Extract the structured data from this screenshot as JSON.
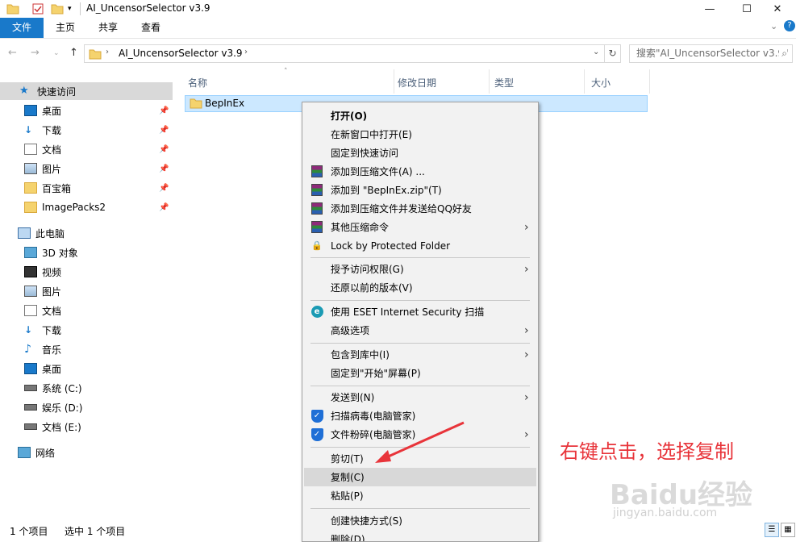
{
  "window": {
    "title": "AI_UncensorSelector v3.9",
    "minimize_icon": "minimize-icon",
    "maximize_icon": "maximize-icon",
    "close_icon": "close-icon"
  },
  "ribbon": {
    "tabs": [
      "文件",
      "主页",
      "共享",
      "查看"
    ],
    "help_glyph": "?"
  },
  "address": {
    "path_segment": "AI_UncensorSelector v3.9",
    "search_placeholder": "搜索\"AI_UncensorSelector v3.9\""
  },
  "sidebar": {
    "quick_access": "快速访问",
    "quick_items": [
      "桌面",
      "下载",
      "文档",
      "图片",
      "百宝箱",
      "ImagePacks2"
    ],
    "this_pc": "此电脑",
    "pc_items": [
      "3D 对象",
      "视频",
      "图片",
      "文档",
      "下载",
      "音乐",
      "桌面",
      "系统 (C:)",
      "娱乐 (D:)",
      "文档 (E:)"
    ],
    "network": "网络"
  },
  "filelist": {
    "columns": [
      "名称",
      "修改日期",
      "类型",
      "大小"
    ],
    "rows": [
      {
        "name": "BepInEx"
      }
    ]
  },
  "status": {
    "item_count": "1 个项目",
    "selected": "选中 1 个项目"
  },
  "context_menu": {
    "groups": [
      [
        "打开(O)",
        "在新窗口中打开(E)",
        "固定到快速访问",
        "添加到压缩文件(A) ...",
        "添加到 \"BepInEx.zip\"(T)",
        "添加到压缩文件并发送给QQ好友",
        "其他压缩命令",
        "Lock by Protected Folder"
      ],
      [
        "授予访问权限(G)",
        "还原以前的版本(V)"
      ],
      [
        "使用 ESET Internet Security 扫描",
        "高级选项"
      ],
      [
        "包含到库中(I)",
        "固定到\"开始\"屏幕(P)"
      ],
      [
        "发送到(N)",
        "扫描病毒(电脑管家)",
        "文件粉碎(电脑管家)"
      ],
      [
        "剪切(T)",
        "复制(C)",
        "粘贴(P)"
      ],
      [
        "创建快捷方式(S)",
        "删除(D)"
      ]
    ],
    "highlighted": "复制(C)"
  },
  "annotation": {
    "text": "右键点击，选择复制",
    "color": "#e8343a"
  },
  "watermark": {
    "brand": "Baidu经验",
    "url": "jingyan.baidu.com"
  },
  "colors": {
    "file_tab_bg": "#1979ca",
    "selection_bg": "#cce8ff",
    "menu_bg": "#f2f2f2"
  }
}
